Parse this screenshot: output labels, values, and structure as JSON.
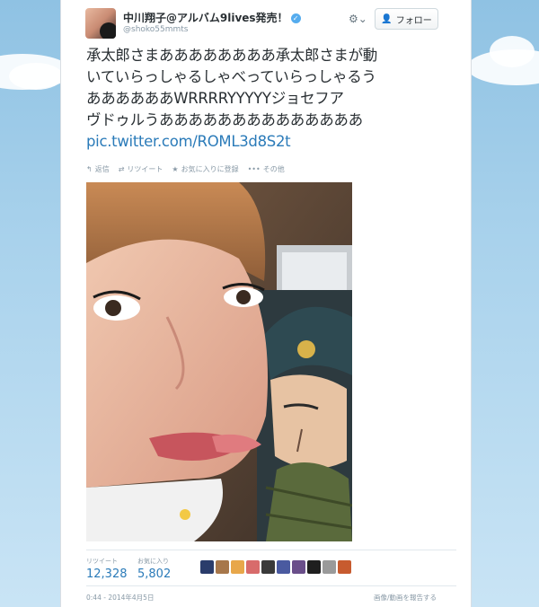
{
  "user": {
    "name": "中川翔子@アルバム9lives発売！",
    "handle": "@shoko55mmts"
  },
  "follow_button": {
    "label": "フォロー"
  },
  "tweet": {
    "lines": [
      "承太郎さまああああああああ承太郎さまが動",
      "いていらっしゃるしゃべっていらっしゃるう",
      "ああああああWRRRRYYYYYジョセフア",
      "ヴドゥルうああああああああああああああ"
    ],
    "link": "pic.twitter.com/ROML3d8S2t"
  },
  "actions": {
    "reply": "返信",
    "retweet": "リツイート",
    "favorite": "お気に入りに登録",
    "more": "その他"
  },
  "stats": {
    "retweet_label": "リツイート",
    "retweet_count": "12,328",
    "favorite_label": "お気に入り",
    "favorite_count": "5,802"
  },
  "footer": {
    "timestamp": "0:44 - 2014年4月5日",
    "report": "画像/動画を報告する"
  },
  "colors": {
    "link": "#2b7bb9",
    "verified": "#55acee",
    "muted": "#8899a6",
    "text": "#292f33"
  }
}
